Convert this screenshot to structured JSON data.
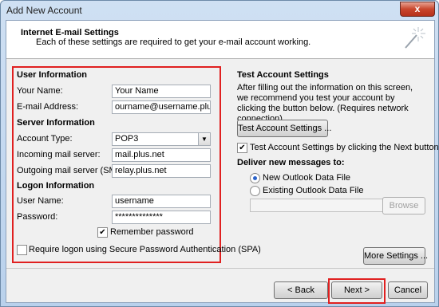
{
  "window": {
    "title": "Add New Account",
    "close_glyph": "x"
  },
  "header": {
    "title": "Internet E-mail Settings",
    "subtitle": "Each of these settings are required to get your e-mail account working."
  },
  "user_info": {
    "heading": "User Information",
    "name_label": "Your Name:",
    "name_value": "Your Name",
    "email_label": "E-mail Address:",
    "email_value": "ourname@username.plus.com"
  },
  "server_info": {
    "heading": "Server Information",
    "account_type_label": "Account Type:",
    "account_type_value": "POP3",
    "incoming_label": "Incoming mail server:",
    "incoming_value": "mail.plus.net",
    "outgoing_label": "Outgoing mail server (SMTP):",
    "outgoing_value": "relay.plus.net"
  },
  "logon_info": {
    "heading": "Logon Information",
    "username_label": "User Name:",
    "username_value": "username",
    "password_label": "Password:",
    "password_value": "**************",
    "remember_label": "Remember password",
    "remember_checked": true
  },
  "spa": {
    "label": "Require logon using Secure Password Authentication (SPA)",
    "checked": false
  },
  "test": {
    "heading": "Test Account Settings",
    "description": "After filling out the information on this screen, we recommend you test your account by clicking the button below. (Requires network connection)",
    "button_label": "Test Account Settings ...",
    "auto_test_label": "Test Account Settings by clicking the Next button",
    "auto_test_checked": true
  },
  "deliver": {
    "heading": "Deliver new messages to:",
    "option_new": "New Outlook Data File",
    "option_existing": "Existing Outlook Data File",
    "browse_label": "Browse",
    "existing_path": ""
  },
  "buttons": {
    "more_settings": "More Settings ...",
    "back": "< Back",
    "next": "Next >",
    "cancel": "Cancel"
  },
  "colors": {
    "highlight_border": "#e02020",
    "radio_dot": "#2a62c9"
  }
}
